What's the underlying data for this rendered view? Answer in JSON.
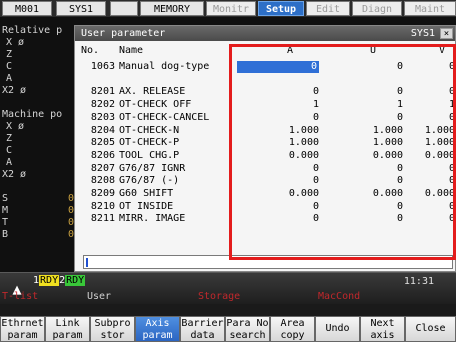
{
  "topbar": {
    "status": "M001",
    "system": "SYS1",
    "memory": "MEMORY",
    "tabs": [
      "Monitr",
      "Setup",
      "Edit",
      "Diagn",
      "Maint"
    ]
  },
  "background": {
    "relative": "Relative p",
    "machine": "Machine po",
    "axes_rel": [
      "X ø",
      "Z",
      "C",
      "A",
      "X2 ø"
    ],
    "axes_mach": [
      "X ø",
      "Z",
      "C",
      "A",
      "X2 ø"
    ],
    "smtb": [
      "S",
      "M",
      "T",
      "B"
    ],
    "smtb_digits": [
      "0",
      "0",
      "0",
      "0"
    ]
  },
  "dialog": {
    "title": "User parameter",
    "system": "SYS1",
    "close": "×",
    "headers": {
      "no": "No.",
      "name": "Name",
      "a": "A",
      "u": "U",
      "v": "V"
    },
    "rows": [
      {
        "no": "1063",
        "name": "Manual dog-type",
        "a": "0",
        "u": "0",
        "v": "0",
        "selected": true
      },
      {
        "no": "",
        "name": "",
        "a": "",
        "u": "",
        "v": ""
      },
      {
        "no": "8201",
        "name": "AX. RELEASE",
        "a": "0",
        "u": "0",
        "v": "0"
      },
      {
        "no": "8202",
        "name": "OT-CHECK OFF",
        "a": "1",
        "u": "1",
        "v": "1"
      },
      {
        "no": "8203",
        "name": "OT-CHECK-CANCEL",
        "a": "0",
        "u": "0",
        "v": "0"
      },
      {
        "no": "8204",
        "name": "OT-CHECK-N",
        "a": "1.000",
        "u": "1.000",
        "v": "1.000"
      },
      {
        "no": "8205",
        "name": "OT-CHECK-P",
        "a": "1.000",
        "u": "1.000",
        "v": "1.000"
      },
      {
        "no": "8206",
        "name": "TOOL CHG.P",
        "a": "0.000",
        "u": "0.000",
        "v": "0.000"
      },
      {
        "no": "8207",
        "name": "G76/87 IGNR",
        "a": "0",
        "u": "0",
        "v": "0"
      },
      {
        "no": "8208",
        "name": "G76/87 (-)",
        "a": "0",
        "u": "0",
        "v": "0"
      },
      {
        "no": "8209",
        "name": "G60 SHIFT",
        "a": "0.000",
        "u": "0.000",
        "v": "0.000"
      },
      {
        "no": "8210",
        "name": "OT INSIDE",
        "a": "0",
        "u": "0",
        "v": "0"
      },
      {
        "no": "8211",
        "name": "MIRR. IMAGE",
        "a": "0",
        "u": "0",
        "v": "0"
      }
    ]
  },
  "status": {
    "up_arrow": "▲",
    "rdy1_num": "1",
    "rdy1": "RDY",
    "rdy2_num": "2",
    "rdy2": "RDY",
    "time": "11:31",
    "groups": [
      "T-list",
      "User",
      "Storage",
      "MacCond"
    ]
  },
  "softkeys": [
    {
      "l1": "Ethrnet",
      "l2": "param"
    },
    {
      "l1": "Link",
      "l2": "param"
    },
    {
      "l1": "Subpro",
      "l2": "stor"
    },
    {
      "l1": "Axis",
      "l2": "param",
      "active": true
    },
    {
      "l1": "Barrier",
      "l2": "data"
    },
    {
      "l1": "Para No",
      "l2": "search"
    },
    {
      "l1": "Area",
      "l2": "copy"
    },
    {
      "l1": "Undo",
      "l2": ""
    },
    {
      "l1": "Next",
      "l2": "axis"
    },
    {
      "l1": "Close",
      "l2": ""
    }
  ]
}
